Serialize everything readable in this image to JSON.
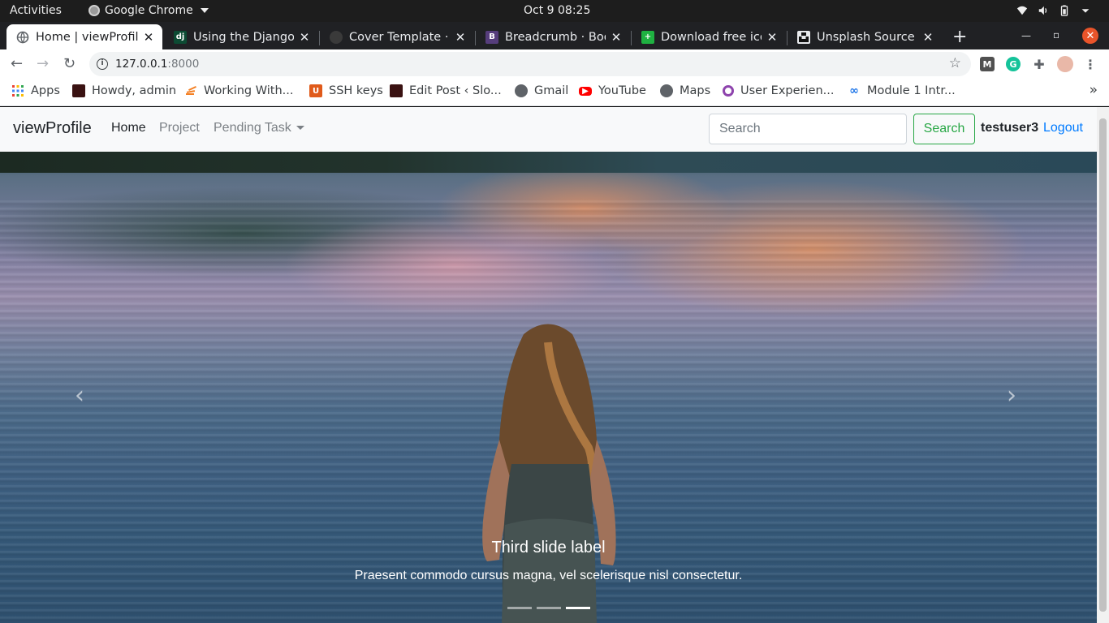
{
  "system_bar": {
    "activities": "Activities",
    "app_name": "Google Chrome",
    "clock": "Oct 9  08:25"
  },
  "tabs": [
    {
      "title": "Home | viewProfile",
      "favicon": "globe-icon",
      "active": true
    },
    {
      "title": "Using the Django a",
      "favicon": "django-icon",
      "active": false
    },
    {
      "title": "Cover Template · B",
      "favicon": "github-icon",
      "active": false
    },
    {
      "title": "Breadcrumb · Boot",
      "favicon": "bootstrap-icon",
      "active": false
    },
    {
      "title": "Download free ico",
      "favicon": "icons-icon",
      "active": false
    },
    {
      "title": "Unsplash Source | A",
      "favicon": "unsplash-icon",
      "active": false
    }
  ],
  "address_bar": {
    "host": "127.0.0.1",
    "port": ":8000"
  },
  "bookmarks": [
    {
      "label": "Apps",
      "icon": "apps-grid-icon"
    },
    {
      "label": "Howdy, admin",
      "icon": "site-icon"
    },
    {
      "label": "Working With...",
      "icon": "stack-icon"
    },
    {
      "label": "SSH keys",
      "icon": "u-icon"
    },
    {
      "label": "Edit Post ‹ Slo...",
      "icon": "site-icon"
    },
    {
      "label": "Gmail",
      "icon": "globe-icon"
    },
    {
      "label": "YouTube",
      "icon": "youtube-icon"
    },
    {
      "label": "Maps",
      "icon": "globe-icon"
    },
    {
      "label": "User Experien...",
      "icon": "ring-icon"
    },
    {
      "label": "Module 1 Intr...",
      "icon": "infinity-icon"
    }
  ],
  "navbar": {
    "brand": "viewProfile",
    "links": [
      "Home",
      "Project",
      "Pending Task"
    ],
    "search_placeholder": "Search",
    "search_button": "Search",
    "username": "testuser3",
    "logout": "Logout"
  },
  "carousel": {
    "caption_title": "Third slide label",
    "caption_text": "Praesent commodo cursus magna, vel scelerisque nisl consectetur.",
    "slide_count": 3,
    "active_slide": 3
  },
  "colors": {
    "success": "#28a745",
    "link": "#007bff",
    "close_button": "#e9542a"
  }
}
